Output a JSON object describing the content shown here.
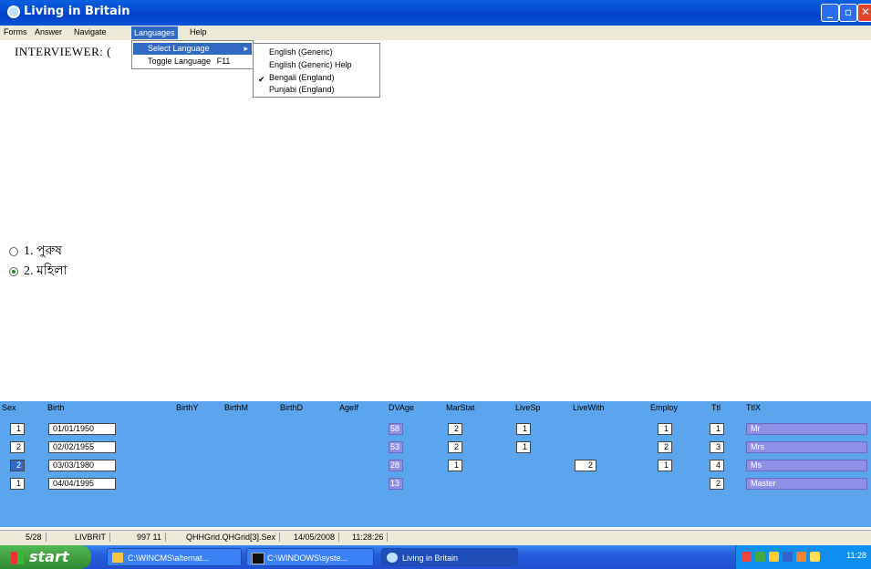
{
  "window": {
    "title": "Living in Britain"
  },
  "menubar": {
    "items": [
      "Forms",
      "Answer",
      "Navigate",
      "Languages",
      "Help"
    ]
  },
  "languages_menu": {
    "items": [
      {
        "label": "Select Language",
        "has_submenu": true
      },
      {
        "label": "Toggle Language",
        "shortcut": "F11"
      }
    ],
    "submenu": [
      "English (Generic)",
      "English (Generic) Help",
      "Bengali (England)",
      "Punjabi (England)"
    ],
    "checked": "Bengali (England)"
  },
  "question": {
    "prefix": "INTERVIEWER: ("
  },
  "options": [
    {
      "label": "1. পুরুষ",
      "selected": false
    },
    {
      "label": "2. মহিলা",
      "selected": true
    }
  ],
  "grid": {
    "headers": [
      "Sex",
      "Birth",
      "BirthY",
      "BirthM",
      "BirthD",
      "AgeIf",
      "DVAge",
      "MarStat",
      "LiveSp",
      "LiveWith",
      "Employ",
      "Ttl",
      "TtlX"
    ],
    "rows": [
      {
        "sex": "1",
        "birth": "01/01/1950",
        "dvage": "58",
        "marstat": "2",
        "livesp": "1",
        "livewith": "",
        "employ": "1",
        "ttl": "1",
        "ttlx": "Mr"
      },
      {
        "sex": "2",
        "birth": "02/02/1955",
        "dvage": "53",
        "marstat": "2",
        "livesp": "1",
        "livewith": "",
        "employ": "2",
        "ttl": "3",
        "ttlx": "Mrs"
      },
      {
        "sex": "2",
        "birth": "03/03/1980",
        "dvage": "28",
        "marstat": "1",
        "livesp": "",
        "livewith": "2",
        "employ": "1",
        "ttl": "4",
        "ttlx": "Ms"
      },
      {
        "sex": "1",
        "birth": "04/04/1995",
        "dvage": "13",
        "marstat": "",
        "livesp": "",
        "livewith": "",
        "employ": "",
        "ttl": "2",
        "ttlx": "Master"
      }
    ]
  },
  "status": {
    "page": "5/28",
    "survey": "LIVBRIT",
    "code": "997 11",
    "field": "QHHGrid.QHGrid[3].Sex",
    "date": "14/05/2008",
    "time": "11:28:26"
  },
  "taskbar": {
    "start": "start",
    "tasks": [
      "C:\\WINCMS\\alternat...",
      "C:\\WINDOWS\\syste...",
      "Living in Britain"
    ],
    "clock": "11:28"
  }
}
